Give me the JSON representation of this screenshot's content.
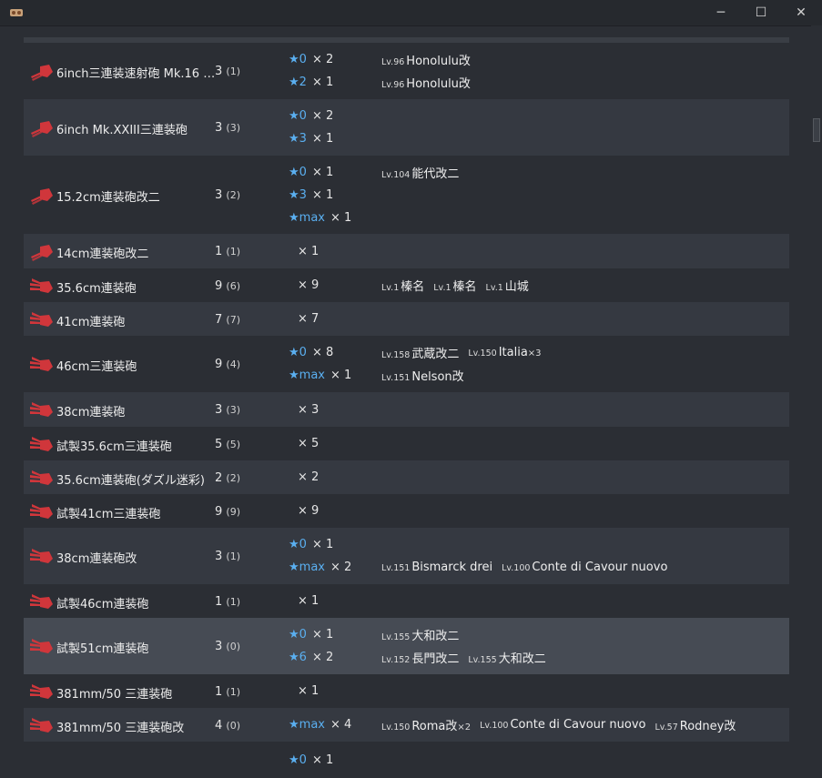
{
  "colors": {
    "star": "#5aaff0",
    "row_alt": "#353941",
    "row_highlight": "#464b54",
    "icon_red": "#d0363b"
  },
  "window": {
    "icon": "app-icon",
    "minimize": "─",
    "maximize": "☐",
    "close": "✕"
  },
  "rows": [
    {
      "name": "6inch三連装速射砲 Mk.16 …",
      "count": "3",
      "sub": "(1)",
      "icon": "small-gun-icon",
      "style": "normal",
      "levels": [
        {
          "star": "★0",
          "mult": "× 2"
        },
        {
          "star": "★2",
          "mult": "× 1"
        }
      ],
      "ships": [
        [
          {
            "lv": "Lv.96",
            "name": "Honolulu改",
            "cnt": ""
          }
        ],
        [
          {
            "lv": "Lv.96",
            "name": "Honolulu改",
            "cnt": ""
          }
        ]
      ]
    },
    {
      "name": "6inch Mk.XXIII三連装砲",
      "count": "3",
      "sub": "(3)",
      "icon": "small-gun-icon",
      "style": "alt",
      "levels": [
        {
          "star": "★0",
          "mult": "× 2"
        },
        {
          "star": "★3",
          "mult": "× 1"
        }
      ],
      "ships": [
        [],
        []
      ]
    },
    {
      "name": "15.2cm連装砲改二",
      "count": "3",
      "sub": "(2)",
      "icon": "small-gun-icon",
      "style": "normal",
      "levels": [
        {
          "star": "★0",
          "mult": "× 1"
        },
        {
          "star": "★3",
          "mult": "× 1"
        },
        {
          "star": "★max",
          "mult": "× 1"
        }
      ],
      "ships": [
        [
          {
            "lv": "Lv.104",
            "name": "能代改二",
            "cnt": ""
          }
        ],
        [],
        []
      ]
    },
    {
      "name": "14cm連装砲改二",
      "count": "1",
      "sub": "(1)",
      "icon": "small-gun-icon",
      "style": "alt",
      "levels": [
        {
          "star": "",
          "mult": "× 1"
        }
      ],
      "ships": [
        []
      ]
    },
    {
      "name": "35.6cm連装砲",
      "count": "9",
      "sub": "(6)",
      "icon": "large-gun-icon",
      "style": "normal",
      "levels": [
        {
          "star": "",
          "mult": "× 9"
        }
      ],
      "ships": [
        [
          {
            "lv": "Lv.1",
            "name": "榛名",
            "cnt": ""
          },
          {
            "lv": "Lv.1",
            "name": "榛名",
            "cnt": ""
          },
          {
            "lv": "Lv.1",
            "name": "山城",
            "cnt": ""
          }
        ]
      ]
    },
    {
      "name": "41cm連装砲",
      "count": "7",
      "sub": "(7)",
      "icon": "large-gun-icon",
      "style": "alt",
      "levels": [
        {
          "star": "",
          "mult": "× 7"
        }
      ],
      "ships": [
        []
      ]
    },
    {
      "name": "46cm三連装砲",
      "count": "9",
      "sub": "(4)",
      "icon": "large-gun-icon",
      "style": "normal",
      "levels": [
        {
          "star": "★0",
          "mult": "× 8"
        },
        {
          "star": "★max",
          "mult": "× 1"
        }
      ],
      "ships": [
        [
          {
            "lv": "Lv.158",
            "name": "武蔵改二",
            "cnt": ""
          },
          {
            "lv": "Lv.150",
            "name": "Italia",
            "cnt": "×3"
          }
        ],
        [
          {
            "lv": "Lv.151",
            "name": "Nelson改",
            "cnt": ""
          }
        ]
      ]
    },
    {
      "name": "38cm連装砲",
      "count": "3",
      "sub": "(3)",
      "icon": "large-gun-icon",
      "style": "alt",
      "levels": [
        {
          "star": "",
          "mult": "× 3"
        }
      ],
      "ships": [
        []
      ]
    },
    {
      "name": "試製35.6cm三連装砲",
      "count": "5",
      "sub": "(5)",
      "icon": "large-gun-icon",
      "style": "normal",
      "levels": [
        {
          "star": "",
          "mult": "× 5"
        }
      ],
      "ships": [
        []
      ]
    },
    {
      "name": "35.6cm連装砲(ダズル迷彩)",
      "count": "2",
      "sub": "(2)",
      "icon": "large-gun-icon",
      "style": "alt",
      "levels": [
        {
          "star": "",
          "mult": "× 2"
        }
      ],
      "ships": [
        []
      ]
    },
    {
      "name": "試製41cm三連装砲",
      "count": "9",
      "sub": "(9)",
      "icon": "large-gun-icon",
      "style": "normal",
      "levels": [
        {
          "star": "",
          "mult": "× 9"
        }
      ],
      "ships": [
        []
      ]
    },
    {
      "name": "38cm連装砲改",
      "count": "3",
      "sub": "(1)",
      "icon": "large-gun-icon",
      "style": "alt",
      "levels": [
        {
          "star": "★0",
          "mult": "× 1"
        },
        {
          "star": "★max",
          "mult": "× 2"
        }
      ],
      "ships": [
        [],
        [
          {
            "lv": "Lv.151",
            "name": "Bismarck drei",
            "cnt": ""
          },
          {
            "lv": "Lv.100",
            "name": "Conte di Cavour nuovo",
            "cnt": ""
          }
        ]
      ]
    },
    {
      "name": "試製46cm連装砲",
      "count": "1",
      "sub": "(1)",
      "icon": "large-gun-icon",
      "style": "normal",
      "levels": [
        {
          "star": "",
          "mult": "× 1"
        }
      ],
      "ships": [
        []
      ]
    },
    {
      "name": "試製51cm連装砲",
      "count": "3",
      "sub": "(0)",
      "icon": "large-gun-icon",
      "style": "hl",
      "levels": [
        {
          "star": "★0",
          "mult": "× 1"
        },
        {
          "star": "★6",
          "mult": "× 2"
        }
      ],
      "ships": [
        [
          {
            "lv": "Lv.155",
            "name": "大和改二",
            "cnt": ""
          }
        ],
        [
          {
            "lv": "Lv.152",
            "name": "長門改二",
            "cnt": ""
          },
          {
            "lv": "Lv.155",
            "name": "大和改二",
            "cnt": ""
          }
        ]
      ]
    },
    {
      "name": "381mm/50 三連装砲",
      "count": "1",
      "sub": "(1)",
      "icon": "large-gun-icon",
      "style": "normal",
      "levels": [
        {
          "star": "",
          "mult": "× 1"
        }
      ],
      "ships": [
        []
      ]
    },
    {
      "name": "381mm/50 三連装砲改",
      "count": "4",
      "sub": "(0)",
      "icon": "large-gun-icon",
      "style": "alt",
      "levels": [
        {
          "star": "★max",
          "mult": "× 4"
        }
      ],
      "ships": [
        [
          {
            "lv": "Lv.150",
            "name": "Roma改",
            "cnt": "×2"
          },
          {
            "lv": "Lv.100",
            "name": "Conte di Cavour nuovo",
            "cnt": ""
          },
          {
            "lv": "Lv.57",
            "name": "Rodney改",
            "cnt": ""
          }
        ]
      ]
    },
    {
      "name": "",
      "count": "",
      "sub": "",
      "icon": "",
      "style": "normal",
      "levels": [
        {
          "star": "★0",
          "mult": "× 1"
        }
      ],
      "ships": [
        []
      ]
    }
  ]
}
